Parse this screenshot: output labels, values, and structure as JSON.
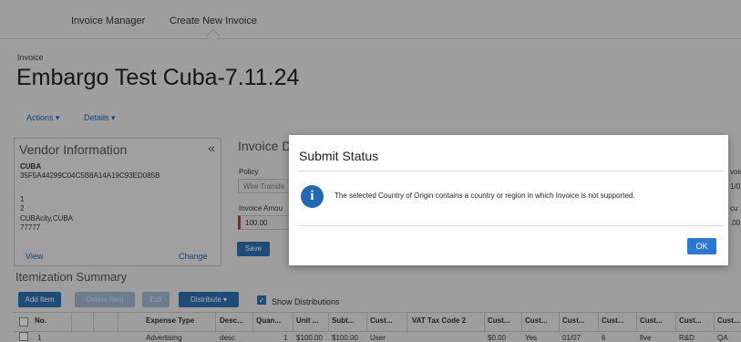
{
  "nav": {
    "tabs": [
      "Invoice Manager",
      "Create New Invoice"
    ]
  },
  "header": {
    "crumb": "Invoice",
    "title": "Embargo Test Cuba-7.11.24"
  },
  "menus": {
    "actions": "Actions ▾",
    "details": "Details ▾"
  },
  "vendor": {
    "heading": "Vendor Information",
    "collapse_glyph": "«",
    "name": "CUBA",
    "id": "35F5A44299C04C5B8A14A19C93ED085B",
    "line1": "1",
    "line2": "2",
    "city": "CUBAcity,CUBA",
    "zip": "77777",
    "view_link": "View",
    "change_link": "Change"
  },
  "invoice_details": {
    "heading": "Invoice D",
    "policy_label": "Policy",
    "policy_value": "Wire Transfe",
    "amount_label": "Invoice Amou",
    "amount_value": "100.00",
    "save_label": "Save",
    "right_label_1": "voic",
    "right_value_1": "1/0",
    "right_label_2": "cu",
    "right_value_2": ".00"
  },
  "itemization": {
    "heading": "Itemization Summary",
    "add_item": "Add Item",
    "disabled_1": "Delete Item",
    "disabled_2": "Edit",
    "distribute": "Distribute ▾",
    "show_distributions": "Show Distributions",
    "columns": [
      "No.",
      "Expense Type",
      "Desc...",
      "Quan...",
      "Unit ...",
      "Subt...",
      "Cust...",
      "VAT Tax Code 2",
      "Cust...",
      "Cust...",
      "Cust...",
      "Cust...",
      "Cust...",
      "Cust...",
      "Cust..."
    ],
    "row": [
      "1",
      "Advertising",
      "desc",
      "1",
      "$100.00",
      "$100.00",
      "User",
      "",
      "$0.00",
      "Yes",
      "01/07",
      "6",
      "five",
      "R&D",
      "QA"
    ]
  },
  "modal": {
    "title": "Submit Status",
    "info_glyph": "i",
    "message": "The selected Country of Origin contains a country or region in which Invoice is not supported.",
    "ok_label": "OK",
    "accent": "#2a78d1"
  }
}
